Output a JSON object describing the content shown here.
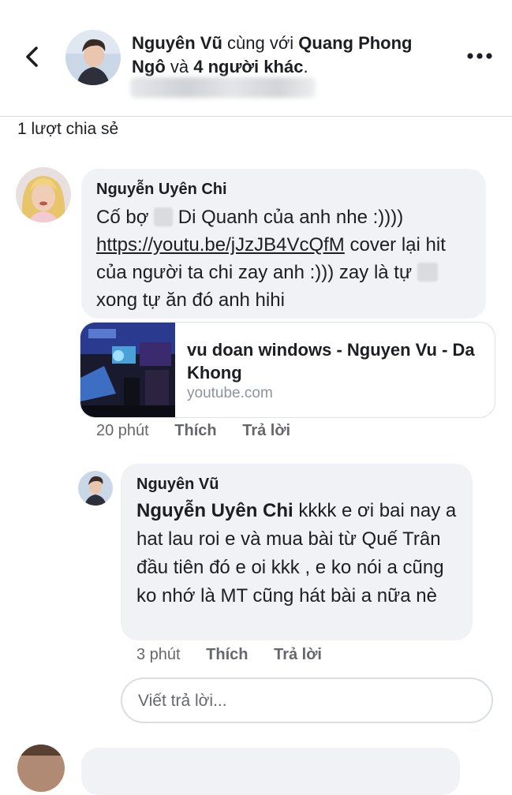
{
  "header": {
    "author": "Nguyên Vũ",
    "with_word": "cùng với",
    "tagged": "Quang Phong Ngô",
    "and_word": "và",
    "others": "4 người khác",
    "period": "."
  },
  "shares": "1 lượt chia sẻ",
  "comment": {
    "author": "Nguyễn Uyên Chi",
    "text_part1": "Cố bợ",
    "text_part2": "Di Quanh của anh nhe :))))",
    "link": "https://youtu.be/jJzJB4VcQfM",
    "text_part3": "cover lại hit của người ta chi zay anh :))) zay là tự",
    "text_part4": "xong tự ăn đó anh hihi",
    "preview": {
      "title": "vu doan windows - Nguyen Vu - Da Khong",
      "domain": "youtube.com"
    },
    "time": "20 phút",
    "like": "Thích",
    "reply": "Trả lời"
  },
  "reply": {
    "author": "Nguyên Vũ",
    "mention": "Nguyễn Uyên Chi",
    "text": "kkkk e ơi bai nay a hat lau roi e và mua bài từ Quế Trân đầu tiên đó e oi kkk , e ko nói a cũng ko nhớ là MT cũng hát bài a nữa nè",
    "time": "3 phút",
    "like": "Thích",
    "reply": "Trả lời"
  },
  "reply_box": {
    "placeholder": "Viết trả lời..."
  },
  "icons": [
    "back-arrow-icon",
    "more-options-icon"
  ],
  "colors": {
    "bubble": "#f0f2f5",
    "meta": "#65676b",
    "domain": "#8d949e"
  }
}
